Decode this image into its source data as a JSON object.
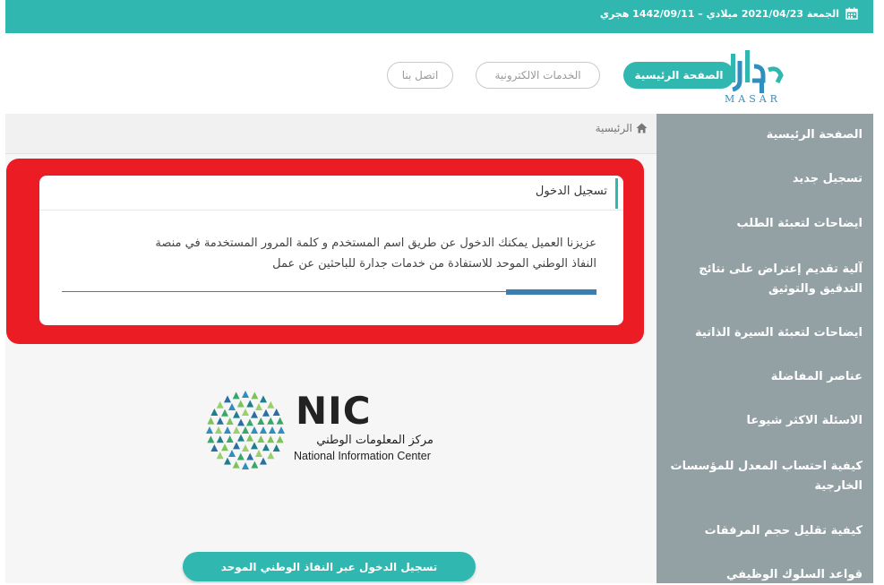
{
  "topbar": {
    "date": "الجمعة 2021/04/23 ميلادي – 1442/09/11 هجري"
  },
  "logo": {
    "text": "MASAR"
  },
  "nav": {
    "home": "الصفحة الرئيسية",
    "eservices": "الخدمات الالكترونية",
    "contact": "اتصل بنا"
  },
  "breadcrumb": {
    "home": "الرئيسية"
  },
  "card": {
    "title": "تسجيل الدخول",
    "line1": "عزيزنا العميل يمكنك الدخول عن طريق اسم المستخدم و كلمة المرور المستخدمة في منصة",
    "line2": "النفاذ الوطني الموحد للاستفادة من خدمات جدارة للباحثين عن عمل",
    "progress": 0.17
  },
  "nic": {
    "abbr": "NIC",
    "arabic": "مركز المعلومات الوطني",
    "english": "National Information Center"
  },
  "login_button": "تسجيل الدخول عبر النفاذ الوطني الموحد",
  "sidebar": {
    "items": [
      "الصفحة الرئيسية",
      "تسجيل جديد",
      "ايضاحات لتعبئة الطلب",
      "آلية تقديم إعتراض على نتائج التدقيق والتوثيق",
      "ايضاحات لتعبئة السيرة الذاتية",
      "عناصر المفاضلة",
      "الاسئلة الاكثر شيوعا",
      "كيفية احتساب المعدل للمؤسسات الخارجية",
      "كيفية تقليل حجم المرفقات",
      "قواعد السلوك الوظيفي"
    ]
  },
  "colors": {
    "accent": "#2fb7b0",
    "sidebar": "#93a1a5",
    "highlight": "#ec1c24",
    "progress": "#3b7fb0"
  },
  "icons": {
    "calendar": "calendar-icon",
    "home": "home-icon"
  }
}
